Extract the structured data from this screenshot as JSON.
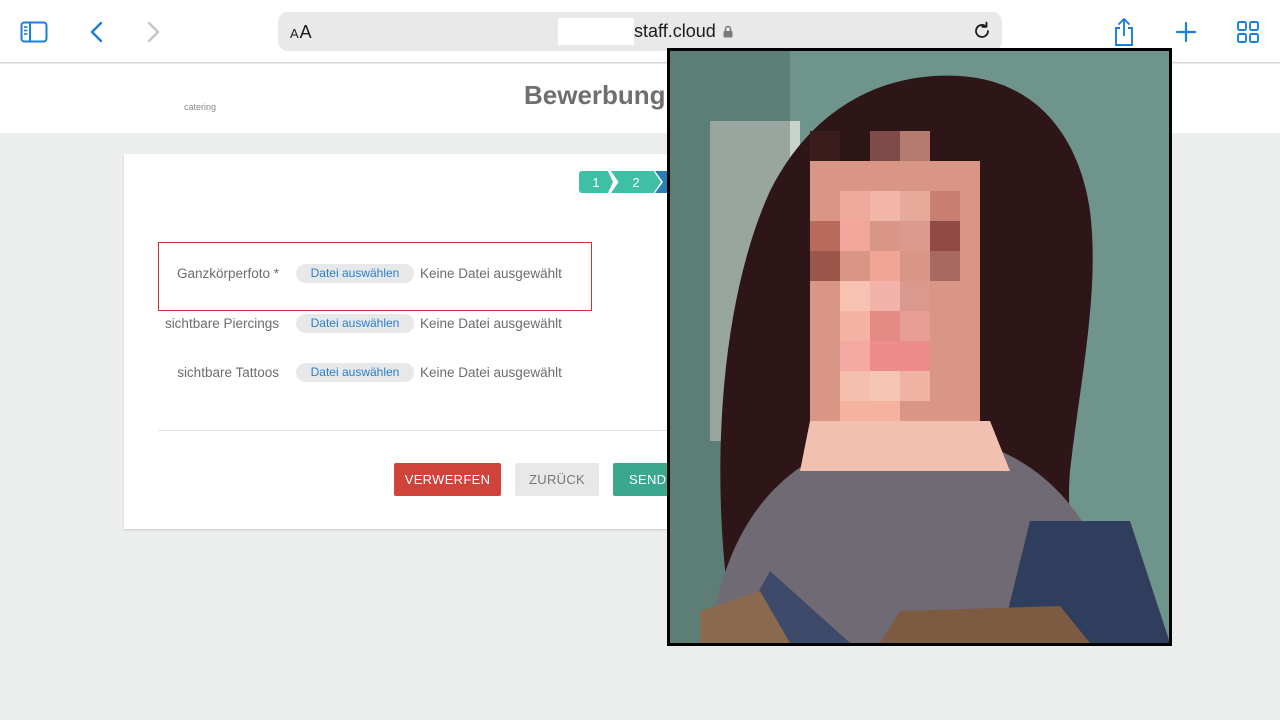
{
  "browser": {
    "address_display": "AA",
    "url_text": "staff.cloud",
    "icons": [
      "sidebar-icon",
      "back-chevron-icon",
      "forward-chevron-icon",
      "lock-icon",
      "reload-icon",
      "share-icon",
      "plus-icon",
      "tabs-grid-icon"
    ]
  },
  "header": {
    "logo_text": "catering",
    "page_title": "Bewerbung"
  },
  "steps": [
    "1",
    "2"
  ],
  "upload_fields": [
    {
      "label": "Ganzkörperfoto *",
      "button": "Datei auswählen",
      "status": "Keine Datei ausgewählt"
    },
    {
      "label": "sichtbare Piercings",
      "button": "Datei auswählen",
      "status": "Keine Datei ausgewählt"
    },
    {
      "label": "sichtbare Tattoos",
      "button": "Datei auswählen",
      "status": "Keine Datei ausgewählt"
    }
  ],
  "actions": {
    "discard": "VERWERFEN",
    "back": "ZURÜCK",
    "send": "SENDE"
  },
  "colors": {
    "accent_blue": "#1a7de0",
    "step_teal": "#3fbfa6",
    "discard_red": "#d0433a",
    "send_green": "#3aa88e",
    "highlight_red": "#d0312d"
  }
}
